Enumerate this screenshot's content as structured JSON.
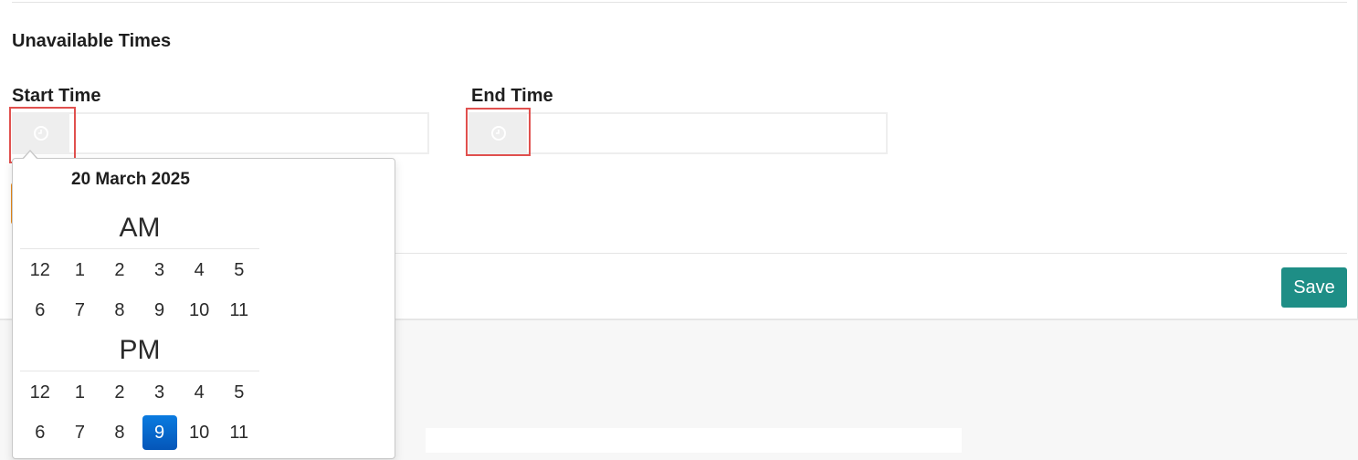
{
  "section": {
    "title": "Unavailable Times"
  },
  "start_time": {
    "label": "Start Time",
    "value": "",
    "addon_icon": "clock-icon"
  },
  "end_time": {
    "label": "End Time",
    "value": "",
    "addon_icon": "clock-icon"
  },
  "save_button": {
    "label": "Save",
    "color": "#1e8e86"
  },
  "picker": {
    "date": "20 March 2025",
    "am": {
      "label": "AM",
      "hours": [
        "12",
        "1",
        "2",
        "3",
        "4",
        "5",
        "6",
        "7",
        "8",
        "9",
        "10",
        "11"
      ]
    },
    "pm": {
      "label": "PM",
      "hours": [
        "12",
        "1",
        "2",
        "3",
        "4",
        "5",
        "6",
        "7",
        "8",
        "9",
        "10",
        "11"
      ]
    },
    "selected": {
      "period": "PM",
      "hour": "9"
    },
    "selected_color": "#0a6fd6"
  },
  "highlight_color": "#e0504e"
}
